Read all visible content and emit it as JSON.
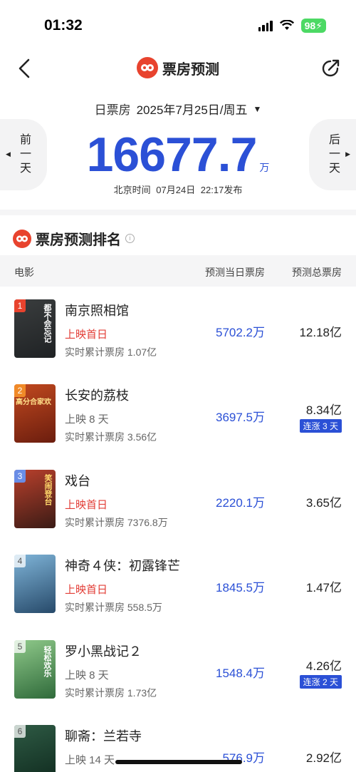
{
  "status_bar": {
    "time": "01:32",
    "battery": "98"
  },
  "nav": {
    "title": "票房预测"
  },
  "day_selector": {
    "label": "日票房",
    "date": "2025年7月25日/周五"
  },
  "side_buttons": {
    "prev": "前一天",
    "next": "后一天"
  },
  "headline": {
    "value": "16677.7",
    "unit": "万",
    "publish": "北京时间  07月24日  22:17发布"
  },
  "section": {
    "title": "票房预测排名"
  },
  "table_header": {
    "movie": "电影",
    "day": "预测当日票房",
    "total": "预测总票房"
  },
  "movies": [
    {
      "rank": "1",
      "name": "南京照相馆",
      "release": "上映首日",
      "cumulative": "实时累计票房 1.07亿",
      "day": "5702.2万",
      "total": "12.18亿",
      "streak": "",
      "poster_colors": [
        "#3a3d3e",
        "#1f2224"
      ],
      "poster_text": "都不会忘记"
    },
    {
      "rank": "2",
      "name": "长安的荔枝",
      "release": "上映 8 天",
      "cumulative": "实时累计票房 3.56亿",
      "day": "3697.5万",
      "total": "8.34亿",
      "streak": "连涨 3 天",
      "poster_colors": [
        "#c1491f",
        "#6b1d0e"
      ],
      "poster_text": "高分合家欢"
    },
    {
      "rank": "3",
      "name": "戏台",
      "release": "上映首日",
      "cumulative": "实时累计票房 7376.8万",
      "day": "2220.1万",
      "total": "3.65亿",
      "streak": "",
      "poster_colors": [
        "#b9402c",
        "#3a1b15"
      ],
      "poster_text": "笑闹登台"
    },
    {
      "rank": "4",
      "name": "神奇４侠：初露锋芒",
      "release": "上映首日",
      "cumulative": "实时累计票房 558.5万",
      "day": "1845.5万",
      "total": "1.47亿",
      "streak": "",
      "poster_colors": [
        "#7fb4d8",
        "#274a6a"
      ],
      "poster_text": ""
    },
    {
      "rank": "5",
      "name": "罗小黑战记２",
      "release": "上映 8 天",
      "cumulative": "实时累计票房 1.73亿",
      "day": "1548.4万",
      "total": "4.26亿",
      "streak": "连涨 2 天",
      "poster_colors": [
        "#8fc98a",
        "#2f6a3a"
      ],
      "poster_text": "轻松欢乐"
    },
    {
      "rank": "6",
      "name": "聊斋：兰若寺",
      "release": "上映 14 天",
      "cumulative": "",
      "day": "576.9万",
      "total": "2.92亿",
      "streak": "",
      "poster_colors": [
        "#2e5a44",
        "#0f2a1e"
      ],
      "poster_text": ""
    }
  ]
}
